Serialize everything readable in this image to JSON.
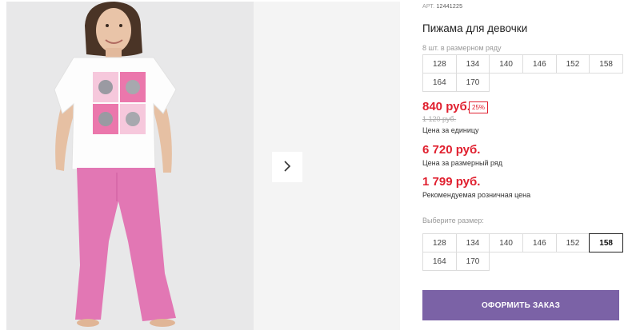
{
  "product": {
    "art_label": "АРТ.",
    "art_number": "12441225",
    "title": "Пижама для девочки",
    "row_note": "8 шт. в размерном ряду",
    "row_sizes": [
      "128",
      "134",
      "140",
      "146",
      "152",
      "158",
      "164",
      "170"
    ],
    "price": "840 руб.",
    "discount": "25%",
    "old_price": "1 120 руб.",
    "price_per_unit_label": "Цена за единицу",
    "row_price": "6 720 руб.",
    "row_price_label": "Цена за размерный ряд",
    "retail_price": "1 799 руб.",
    "retail_price_label": "Рекомендуемая розничная цена",
    "choose_size_label": "Выберите размер:",
    "select_sizes": [
      "128",
      "134",
      "140",
      "146",
      "152",
      "158",
      "164",
      "170"
    ],
    "selected_size": "158",
    "order_button": "ОФОРМИТЬ ЗАКАЗ"
  },
  "gallery": {
    "next_icon": "chevron-right-icon"
  },
  "colors": {
    "price_red": "#e0202f",
    "button_purple": "#7b62a6",
    "pants_pink": "#e277b4"
  }
}
